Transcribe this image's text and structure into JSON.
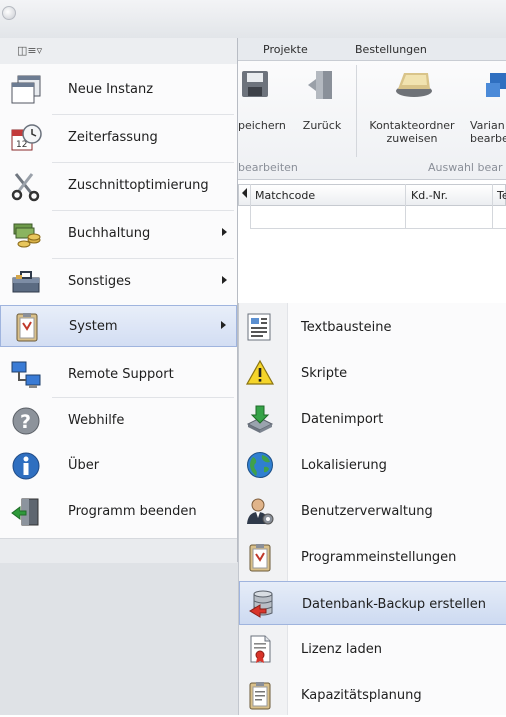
{
  "ribbon": {
    "tabs": [
      "Projekte",
      "Bestellungen"
    ],
    "buttons": {
      "save": "peichern",
      "back": "Zurück",
      "contact_folder": "Kontakteordner\nzuweisen",
      "variants": "Varian\nbearbe"
    },
    "groups": {
      "edit": "bearbeiten",
      "selection": "Auswahl bear"
    }
  },
  "grid": {
    "columns": [
      "Matchcode",
      "Kd.-Nr.",
      "Te"
    ]
  },
  "main_menu": {
    "top_button": "◫≡▿",
    "items": [
      {
        "label": "Neue Instanz",
        "icon": "new-window-icon",
        "submenu": false
      },
      {
        "label": "Zeiterfassung",
        "icon": "calendar-clock-icon",
        "submenu": false
      },
      {
        "label": "Zuschnittoptimierung",
        "icon": "scissors-icon",
        "submenu": false
      },
      {
        "label": "Buchhaltung",
        "icon": "money-icon",
        "submenu": true
      },
      {
        "label": "Sonstiges",
        "icon": "toolbox-icon",
        "submenu": true
      },
      {
        "label": "System",
        "icon": "system-clipboard-icon",
        "submenu": true,
        "active": true
      },
      {
        "label": "Remote Support",
        "icon": "remote-computers-icon",
        "submenu": false
      },
      {
        "label": "Webhilfe",
        "icon": "help-icon",
        "submenu": false
      },
      {
        "label": "Über",
        "icon": "info-icon",
        "submenu": false
      },
      {
        "label": "Programm beenden",
        "icon": "exit-door-icon",
        "submenu": false
      }
    ]
  },
  "system_submenu": {
    "items": [
      {
        "label": "Textbausteine",
        "icon": "text-blocks-icon"
      },
      {
        "label": "Skripte",
        "icon": "warning-icon"
      },
      {
        "label": "Datenimport",
        "icon": "import-icon"
      },
      {
        "label": "Lokalisierung",
        "icon": "globe-icon"
      },
      {
        "label": "Benutzerverwaltung",
        "icon": "user-admin-icon"
      },
      {
        "label": "Programmeinstellungen",
        "icon": "settings-clipboard-icon"
      },
      {
        "label": "Datenbank-Backup erstellen",
        "icon": "database-backup-icon",
        "active": true
      },
      {
        "label": "Lizenz laden",
        "icon": "license-icon"
      },
      {
        "label": "Kapazitätsplanung",
        "icon": "capacity-clipboard-icon"
      }
    ]
  },
  "colors": {
    "highlight": "#d3def3",
    "highlight_border": "#9fb4de"
  }
}
